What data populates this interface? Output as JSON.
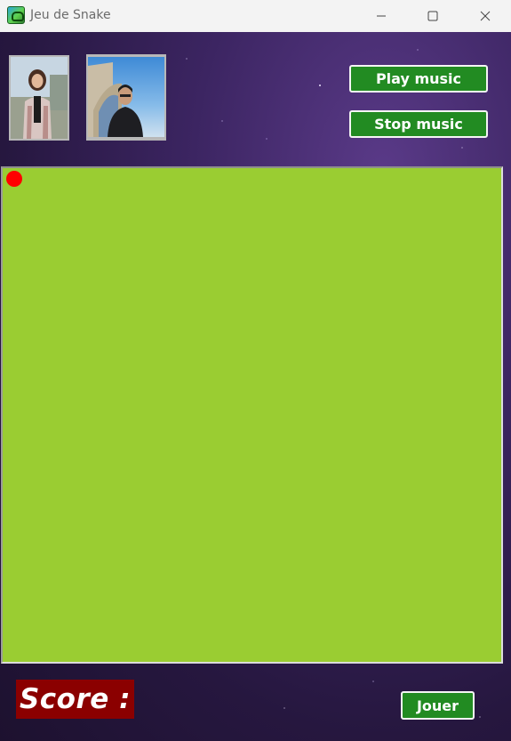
{
  "window": {
    "title": "Jeu de Snake",
    "app_icon": "snake-app-icon",
    "controls": [
      "minimize-icon",
      "maximize-icon",
      "close-icon"
    ]
  },
  "photos": [
    {
      "name": "player-photo-1"
    },
    {
      "name": "player-photo-2"
    }
  ],
  "music": {
    "play_label": "Play music",
    "stop_label": "Stop music"
  },
  "board": {
    "background_color": "#9acd32",
    "snake_color": "#ff0000"
  },
  "score": {
    "label": "Score :",
    "background_color": "#8b0000"
  },
  "actions": {
    "play_label": "Jouer"
  },
  "colors": {
    "button_green": "#228b22",
    "button_border": "#f5f5f5"
  }
}
